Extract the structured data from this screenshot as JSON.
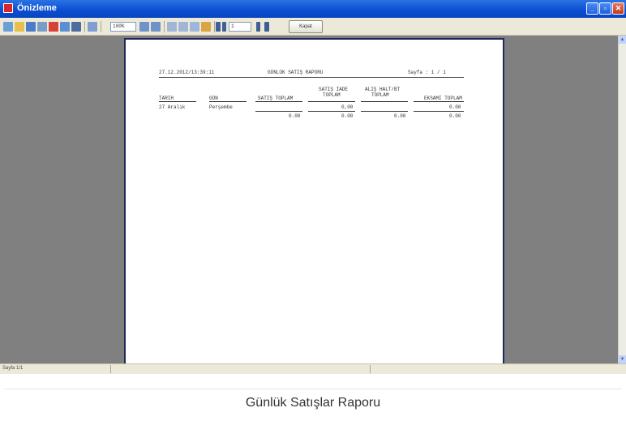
{
  "window": {
    "title": "Önizleme",
    "minimize_glyph": "_",
    "restore_glyph": "▫",
    "close_glyph": "✕"
  },
  "toolbar": {
    "zoom_value": "100%",
    "page_value": "1",
    "close_label": "Kapat",
    "icons": [
      "open-icon",
      "folder-icon",
      "save-icon",
      "print-icon",
      "pdf-icon",
      "copy-icon",
      "binoculars-icon",
      "search-icon",
      "zoom-in-icon",
      "zoom-out-icon",
      "page-setup-icon",
      "single-page-icon",
      "multi-page-icon",
      "thumbnails-icon",
      "edit-icon",
      "first-page-icon",
      "prev-page-icon",
      "next-page-icon",
      "last-page-icon"
    ]
  },
  "report": {
    "datetime": "27.12.2012/13:39:11",
    "title": "GÜNLÜK SATIŞ RAPORU",
    "page_label": "Sayfa : 1 / 1",
    "columns": {
      "tarih": "TARIH",
      "gun": "GÜN",
      "satis_toplam": "SATIŞ TOPLAM",
      "satis_iade_line1": "SATIŞ İADE",
      "satis_iade_line2": "TOPLAM",
      "alis_iade_line1": "ALIŞ HALT/BT",
      "alis_iade_line2": "TOPLAM",
      "ekisme_toplam": "EKSAMI TOPLAM"
    },
    "row": {
      "tarih": "27 Aralık",
      "gun": "Perşembe",
      "satis_iade": "0,00",
      "ekisme": "0.00"
    },
    "totals": {
      "satis": "0.00",
      "satis_iade": "0.00",
      "alis_iade": "0.00",
      "ekisme": "0.00"
    }
  },
  "status": {
    "text": "Sayfa 1/1"
  },
  "caption": "Günlük Satışlar Raporu",
  "colors": {
    "titlebar": "#0a4dcf",
    "preview_background": "#808080",
    "paper_border": "#1f2a5a"
  }
}
